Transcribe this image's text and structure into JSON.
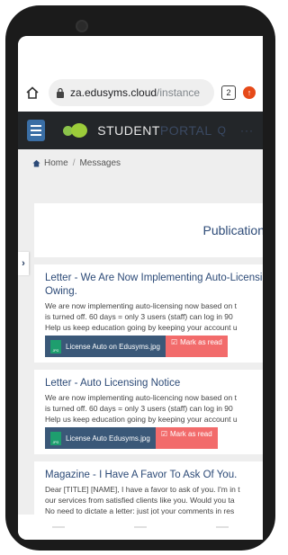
{
  "browser": {
    "url_host": "za.edusyms.cloud",
    "url_path": "/instance",
    "tab_count": "2"
  },
  "header": {
    "logo_part1": "STUDENT",
    "logo_part2": "PORTAL",
    "search_glyph": "Q",
    "more_glyph": "···",
    "accent_color": "#9ccc3a"
  },
  "breadcrumb": {
    "home": "Home",
    "separator": "/",
    "current": "Messages"
  },
  "page": {
    "section_title": "Publication"
  },
  "messages": [
    {
      "title_line1": "Letter - We Are Now Implementing Auto-Licensin",
      "title_line2": "Owing.",
      "body": [
        "We are now implementing auto-licensing now based on t",
        "is turned off. 60 days = only 3 users (staff) can log in 90",
        "Help us keep education going by keeping your account u"
      ],
      "attachment": "License Auto on Edusyms.jpg",
      "mark_read": "Mark as read"
    },
    {
      "title_line1": "Letter - Auto Licensing Notice",
      "body": [
        "We are now implementing auto-licencing now based on t",
        "is turned off. 60 days = only 3 users (staff) can log in 90",
        "Help us keep education going by keeping your account u"
      ],
      "attachment": "License Auto Edusyms.jpg",
      "mark_read": "Mark as read"
    },
    {
      "title_line1": "Magazine - I Have A Favor To Ask Of You.",
      "body": [
        "Dear [TITLE] [NAME], I have a favor to ask of you. I'm in t",
        "our services from satisfied clients like you. Would you ta",
        "No need to dictate a letter: just jot your comments in res"
      ]
    }
  ]
}
